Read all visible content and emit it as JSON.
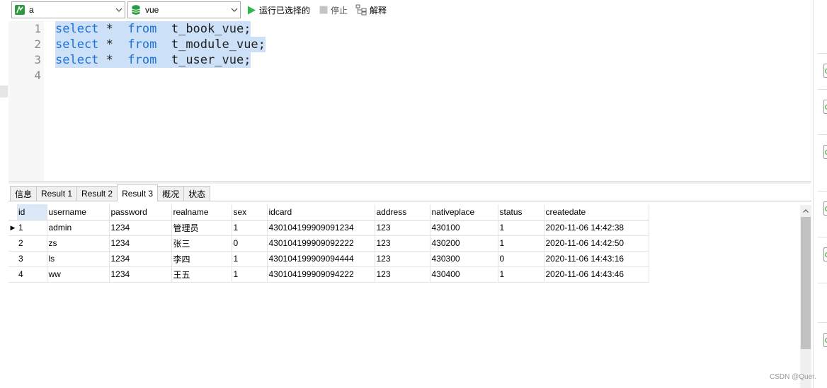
{
  "toolbar": {
    "connection": {
      "value": "a",
      "icon": "connection-icon"
    },
    "database": {
      "value": "vue",
      "icon": "database-icon"
    },
    "run_selected_label": "运行已选择的",
    "stop_label": "停止",
    "explain_label": "解释"
  },
  "editor": {
    "line_numbers": [
      "1",
      "2",
      "3",
      "4"
    ],
    "lines": [
      {
        "kw1": "select",
        "star": "*",
        "kw2": "from",
        "table": "t_book_vue;"
      },
      {
        "kw1": "select",
        "star": "*",
        "kw2": "from",
        "table": "t_module_vue;"
      },
      {
        "kw1": "select",
        "star": "*",
        "kw2": "from",
        "table": "t_user_vue;"
      }
    ]
  },
  "tabs": [
    "信息",
    "Result 1",
    "Result 2",
    "Result 3",
    "概况",
    "状态"
  ],
  "active_tab": "Result 3",
  "grid": {
    "columns": [
      "id",
      "username",
      "password",
      "realname",
      "sex",
      "idcard",
      "address",
      "nativeplace",
      "status",
      "createdate"
    ],
    "rows": [
      [
        "1",
        "admin",
        "1234",
        "管理员",
        "1",
        "430104199909091234",
        "123",
        "430100",
        "1",
        "2020-11-06 14:42:38"
      ],
      [
        "2",
        "zs",
        "1234",
        "张三",
        "0",
        "430104199909092222",
        "123",
        "430200",
        "1",
        "2020-11-06 14:42:50"
      ],
      [
        "3",
        "ls",
        "1234",
        "李四",
        "1",
        "430104199909094444",
        "123",
        "430300",
        "0",
        "2020-11-06 14:43:16"
      ],
      [
        "4",
        "ww",
        "1234",
        "王五",
        "1",
        "430104199909094222",
        "123",
        "430400",
        "1",
        "2020-11-06 14:43:46"
      ]
    ],
    "current_row_marker": "▶"
  },
  "colors": {
    "keyword": "#1e72d6",
    "selection": "#cce0f7",
    "run_icon": "#2db84d"
  },
  "watermark": "CSDN @Quer."
}
